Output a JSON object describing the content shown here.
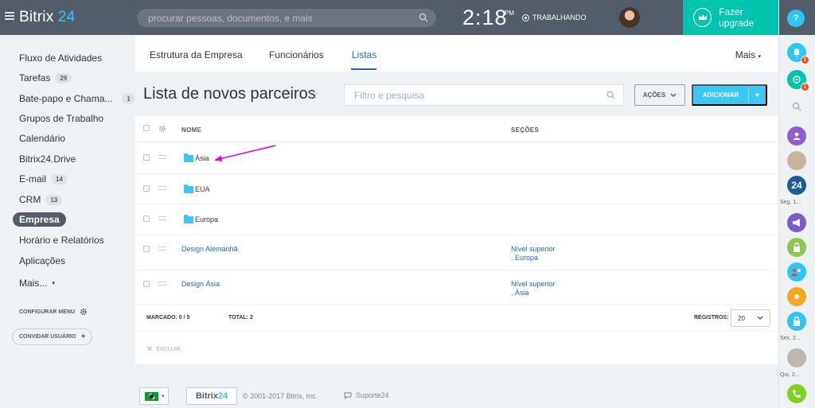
{
  "header": {
    "logo_text": "Bitrix",
    "logo_num": "24",
    "search_placeholder": "procurar pessoas, documentos, e mais",
    "time": "2:18",
    "ampm": "PM",
    "work_status": "TRABALHANDO",
    "upgrade_label": "Fazer upgrade"
  },
  "rail": {
    "help": "?",
    "badge_1": "1",
    "badge_2": "1",
    "b24": "24",
    "caption_1": "Seg, 1...",
    "caption_2": "Sex, 2...",
    "caption_3": "Qui, 2..."
  },
  "sidebar": {
    "items": [
      {
        "label": "Fluxo de Atividades",
        "count": ""
      },
      {
        "label": "Tarefas",
        "count": "29"
      },
      {
        "label": "Bate-papo e Chama...",
        "count": "1"
      },
      {
        "label": "Grupos de Trabalho",
        "count": ""
      },
      {
        "label": "Calendário",
        "count": ""
      },
      {
        "label": "Bitrix24.Drive",
        "count": ""
      },
      {
        "label": "E-mail",
        "count": "14"
      },
      {
        "label": "CRM",
        "count": "13"
      },
      {
        "label": "Empresa",
        "count": ""
      },
      {
        "label": "Horário e Relatórios",
        "count": ""
      },
      {
        "label": "Aplicações",
        "count": ""
      },
      {
        "label": "Mais...",
        "count": ""
      }
    ],
    "config_menu": "CONFIGURAR MENU",
    "invite": "CONVIDAR USUÁRIO"
  },
  "tabs": {
    "items": [
      "Estrutura da Empresa",
      "Funcionários",
      "Listas"
    ],
    "more": "Mais"
  },
  "page": {
    "title": "Lista de novos parceiros",
    "filter_placeholder": "Filtro e pesquisa",
    "actions_label": "AÇÕES",
    "add_label": "ADICIONAR"
  },
  "grid": {
    "columns": {
      "name": "NOME",
      "sections": "SEÇÕES"
    },
    "rows": [
      {
        "type": "folder",
        "name": "Ásia",
        "section_1": "",
        "section_2": ""
      },
      {
        "type": "folder",
        "name": "EUA",
        "section_1": "",
        "section_2": ""
      },
      {
        "type": "folder",
        "name": "Europa",
        "section_1": "",
        "section_2": ""
      },
      {
        "type": "item",
        "name": "Design Alemanhã",
        "section_1": "Nível superior",
        "section_2": ". Europa"
      },
      {
        "type": "item",
        "name": "Design Ásia",
        "section_1": "Nível superior",
        "section_2": ". Ásia"
      }
    ],
    "footer": {
      "marked_label": "MARCADO:",
      "marked_value": "0 / 5",
      "total_label": "TOTAL:",
      "total_value": "2",
      "records_label": "REGISTROS:",
      "records_value": "20"
    },
    "delete_label": "EXCLUIR"
  },
  "footer": {
    "logo_text": "Bitrix",
    "logo_num": "24",
    "copyright": "© 2001-2017 Bitrix, Inc.",
    "support": "Suporte24"
  },
  "colors": {
    "header": "#535c69",
    "accent": "#2fc6f6",
    "upgrade": "#00c4ad",
    "link": "#2067b0",
    "annotation": "#e600e6"
  }
}
